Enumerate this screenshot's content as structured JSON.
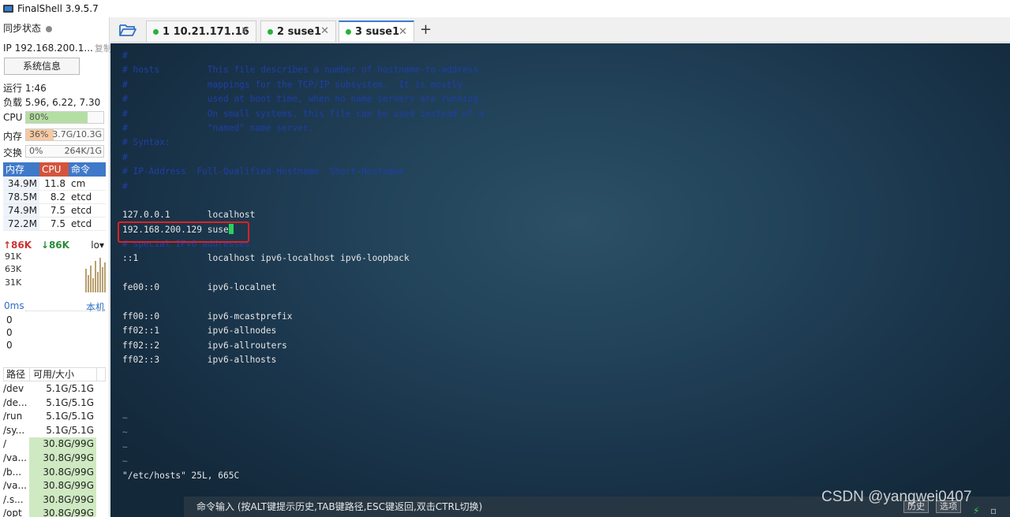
{
  "app": {
    "title": "FinalShell 3.9.5.7"
  },
  "sidebar": {
    "sync_label": "同步状态",
    "ip_label": "IP 192.168.200.1...",
    "copy_label": "复制",
    "sysinfo_button": "系统信息",
    "uptime": "运行 1:46",
    "load": "负载 5.96, 6.22, 7.30",
    "cpu": {
      "label": "CPU",
      "percent_text": "80%",
      "percent": 80,
      "extra": ""
    },
    "memory": {
      "label": "内存",
      "percent_text": "36%",
      "percent": 36,
      "extra": "3.7G/10.3G"
    },
    "swap": {
      "label": "交换",
      "percent_text": "0%",
      "percent": 0,
      "extra": "264K/1G"
    },
    "process_headers": [
      "内存",
      "CPU",
      "命令"
    ],
    "processes": [
      {
        "mem": "34.9M",
        "cpu": "11.8",
        "cmd": "cm"
      },
      {
        "mem": "78.5M",
        "cpu": "8.2",
        "cmd": "etcd"
      },
      {
        "mem": "74.9M",
        "cpu": "7.5",
        "cmd": "etcd"
      },
      {
        "mem": "72.2M",
        "cpu": "7.5",
        "cmd": "etcd"
      }
    ],
    "network": {
      "up": "↑86K",
      "down": "↓86K",
      "iface": "lo",
      "axis": [
        "91K",
        "63K",
        "31K"
      ]
    },
    "latency": {
      "label": "0ms",
      "target": "本机",
      "values": [
        "0",
        "0",
        "0"
      ]
    },
    "disk_headers": [
      "路径",
      "可用/大小"
    ],
    "disks": [
      {
        "path": "/dev",
        "size": "5.1G/5.1G",
        "hot": false
      },
      {
        "path": "/de...",
        "size": "5.1G/5.1G",
        "hot": false
      },
      {
        "path": "/run",
        "size": "5.1G/5.1G",
        "hot": false
      },
      {
        "path": "/sy...",
        "size": "5.1G/5.1G",
        "hot": false
      },
      {
        "path": "/",
        "size": "30.8G/99G",
        "hot": true
      },
      {
        "path": "/va...",
        "size": "30.8G/99G",
        "hot": true
      },
      {
        "path": "/b...",
        "size": "30.8G/99G",
        "hot": true
      },
      {
        "path": "/va...",
        "size": "30.8G/99G",
        "hot": true
      },
      {
        "path": "/.s...",
        "size": "30.8G/99G",
        "hot": true
      },
      {
        "path": "/opt",
        "size": "30.8G/99G",
        "hot": true
      }
    ]
  },
  "tabs": [
    {
      "label": "1 10.21.171.16",
      "active": false
    },
    {
      "label": "2 suse1",
      "active": false
    },
    {
      "label": "3 suse1",
      "active": true
    }
  ],
  "terminal": {
    "lines": [
      {
        "type": "cmt",
        "text": "#"
      },
      {
        "type": "cmt",
        "text": "# hosts         This file describes a number of hostname-to-address"
      },
      {
        "type": "cmt",
        "text": "#               mappings for the TCP/IP subsystem.  It is mostly"
      },
      {
        "type": "cmt",
        "text": "#               used at boot time, when no name servers are running."
      },
      {
        "type": "cmt",
        "text": "#               On small systems, this file can be used instead of a"
      },
      {
        "type": "cmt",
        "text": "#               \"named\" name server."
      },
      {
        "type": "cmt",
        "text": "# Syntax:"
      },
      {
        "type": "cmt",
        "text": "#"
      },
      {
        "type": "cmt",
        "text": "# IP-Address  Full-Qualified-Hostname  Short-Hostname"
      },
      {
        "type": "cmt",
        "text": "#"
      },
      {
        "type": "txt",
        "text": ""
      },
      {
        "type": "txt",
        "text": "127.0.0.1       localhost"
      },
      {
        "type": "cursor",
        "text": "192.168.200.129 suse"
      },
      {
        "type": "cmt",
        "text": "# special IPv6 addresses"
      },
      {
        "type": "txt",
        "text": "::1             localhost ipv6-localhost ipv6-loopback"
      },
      {
        "type": "txt",
        "text": ""
      },
      {
        "type": "txt",
        "text": "fe00::0         ipv6-localnet"
      },
      {
        "type": "txt",
        "text": ""
      },
      {
        "type": "txt",
        "text": "ff00::0         ipv6-mcastprefix"
      },
      {
        "type": "txt",
        "text": "ff02::1         ipv6-allnodes"
      },
      {
        "type": "txt",
        "text": "ff02::2         ipv6-allrouters"
      },
      {
        "type": "txt",
        "text": "ff02::3         ipv6-allhosts"
      },
      {
        "type": "txt",
        "text": ""
      },
      {
        "type": "txt",
        "text": ""
      },
      {
        "type": "txt",
        "text": ""
      },
      {
        "type": "tilde",
        "text": "~"
      },
      {
        "type": "tilde",
        "text": "~"
      },
      {
        "type": "tilde",
        "text": "~"
      },
      {
        "type": "tilde",
        "text": "~"
      },
      {
        "type": "txt",
        "text": "\"/etc/hosts\" 25L, 665C"
      }
    ],
    "cursor_char": "1"
  },
  "command_bar": {
    "hint": "命令输入 (按ALT键提示历史,TAB键路径,ESC键返回,双击CTRL切换)",
    "history_button": "历史",
    "options_button": "选项"
  },
  "watermark": "CSDN @yangwei0407"
}
